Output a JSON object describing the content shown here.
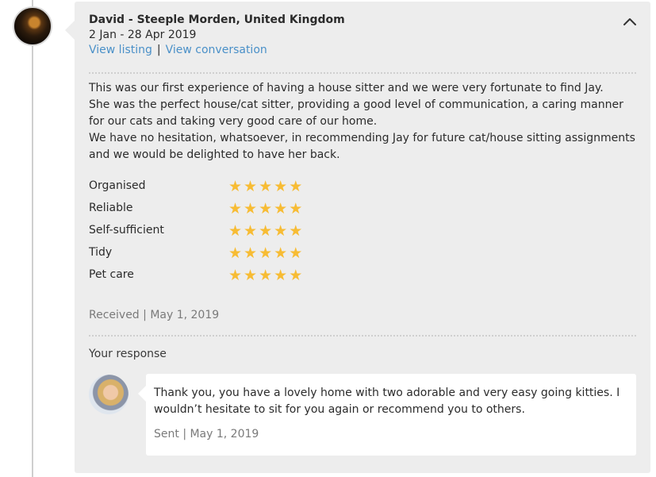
{
  "review": {
    "author": "David - Steeple Morden, United Kingdom",
    "dates": "2 Jan - 28 Apr 2019",
    "links": {
      "view_listing": "View listing",
      "separator": "|",
      "view_conversation": "View conversation"
    },
    "collapse_icon": "chevron-up-icon",
    "text": [
      "This was our first experience of having a house sitter and we were very fortunate to find Jay.",
      "She was the perfect house/cat sitter, providing a good level of communication, a caring manner for our cats and taking very good care of our home.",
      "We have no hesitation, whatsoever, in recommending Jay for future cat/house sitting assignments and we would be delighted to have her back."
    ],
    "ratings": [
      {
        "label": "Organised",
        "stars": 5,
        "max": 5
      },
      {
        "label": "Reliable",
        "stars": 5,
        "max": 5
      },
      {
        "label": "Self-sufficient",
        "stars": 5,
        "max": 5
      },
      {
        "label": "Tidy",
        "stars": 5,
        "max": 5
      },
      {
        "label": "Pet care",
        "stars": 5,
        "max": 5
      }
    ],
    "received": "Received | May 1, 2019"
  },
  "response": {
    "label": "Your response",
    "text": "Thank you, you have a lovely home with two adorable and very easy going kitties. I wouldn’t hesitate to sit for you again or recommend you to others.",
    "sent": "Sent | May 1, 2019"
  },
  "colors": {
    "card_bg": "#ededed",
    "link": "#4a90c8",
    "star": "#f7bc34",
    "muted_text": "#7a7a7a"
  }
}
